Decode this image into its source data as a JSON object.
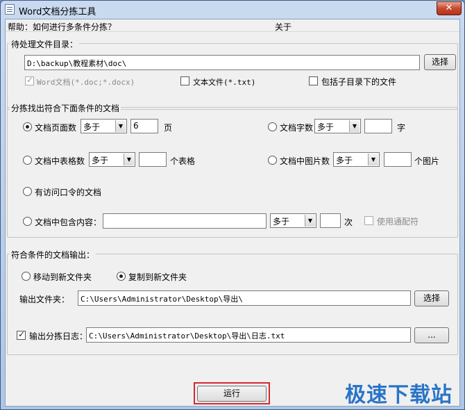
{
  "window": {
    "title": "Word文档分拣工具",
    "close_glyph": "✕"
  },
  "menu": {
    "help": "帮助：如何进行多条件分拣？",
    "about": "关于"
  },
  "source": {
    "legend": "待处理文件目录：",
    "path": "D:\\backup\\教程素材\\doc\\",
    "browse_label": "选择",
    "opt_word": {
      "label": "Word文档(*.doc;*.docx)",
      "checked": true,
      "disabled": true
    },
    "opt_text": {
      "label": "文本文件(*.txt)",
      "checked": false
    },
    "opt_subdir": {
      "label": "包括子目录下的文件",
      "checked": false
    }
  },
  "criteria": {
    "legend": "分拣找出符合下面条件的文档",
    "pages": {
      "label": "文档页面数",
      "compare": "多于",
      "value": "6",
      "unit": "页",
      "selected": true
    },
    "words": {
      "label": "文档字数",
      "compare": "多于",
      "value": "",
      "unit": "字"
    },
    "tables": {
      "label": "文档中表格数",
      "compare": "多于",
      "value": "",
      "unit": "个表格"
    },
    "images": {
      "label": "文档中图片数",
      "compare": "多于",
      "value": "",
      "unit": "个图片"
    },
    "password": {
      "label": "有访问口令的文档"
    },
    "content": {
      "label": "文档中包含内容：",
      "value": "",
      "compare": "多于",
      "count": "",
      "unit": "次",
      "wildcard_label": "使用通配符"
    }
  },
  "output": {
    "legend": "符合条件的文档输出：",
    "move_label": "移动到新文件夹",
    "copy_label": "复制到新文件夹",
    "mode": "copy",
    "folder_label": "输出文件夹：",
    "folder_path": "C:\\Users\\Administrator\\Desktop\\导出\\",
    "folder_browse_label": "选择",
    "log_label": "输出分拣日志：",
    "log_checked": true,
    "log_path": "C:\\Users\\Administrator\\Desktop\\导出\\日志.txt",
    "log_browse_label": "..."
  },
  "run_label": "运行",
  "watermark": "极速下载站",
  "colors": {
    "highlight": "#d8262b",
    "watermark": "#2a74c8",
    "close": "#c74a2f"
  }
}
